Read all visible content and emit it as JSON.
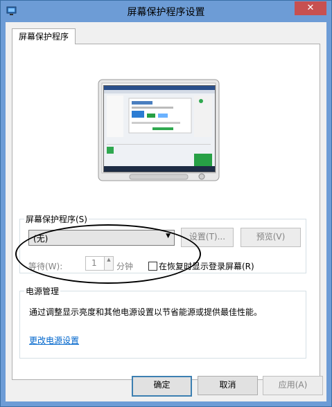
{
  "window": {
    "title": "屏幕保护程序设置",
    "close_glyph": "✕"
  },
  "tab": {
    "label": "屏幕保护程序"
  },
  "screensaver": {
    "group_label": "屏幕保护程序(S)",
    "selected": "(无)",
    "settings_button": "设置(T)...",
    "preview_button": "预览(V)",
    "wait_label": "等待(W):",
    "wait_value": "1",
    "minutes_label": "分钟",
    "resume_label": "在恢复时显示登录屏幕(R)"
  },
  "power": {
    "group_label": "电源管理",
    "description": "通过调整显示亮度和其他电源设置以节省能源或提供最佳性能。",
    "link": "更改电源设置"
  },
  "footer": {
    "ok": "确定",
    "cancel": "取消",
    "apply": "应用(A)"
  }
}
